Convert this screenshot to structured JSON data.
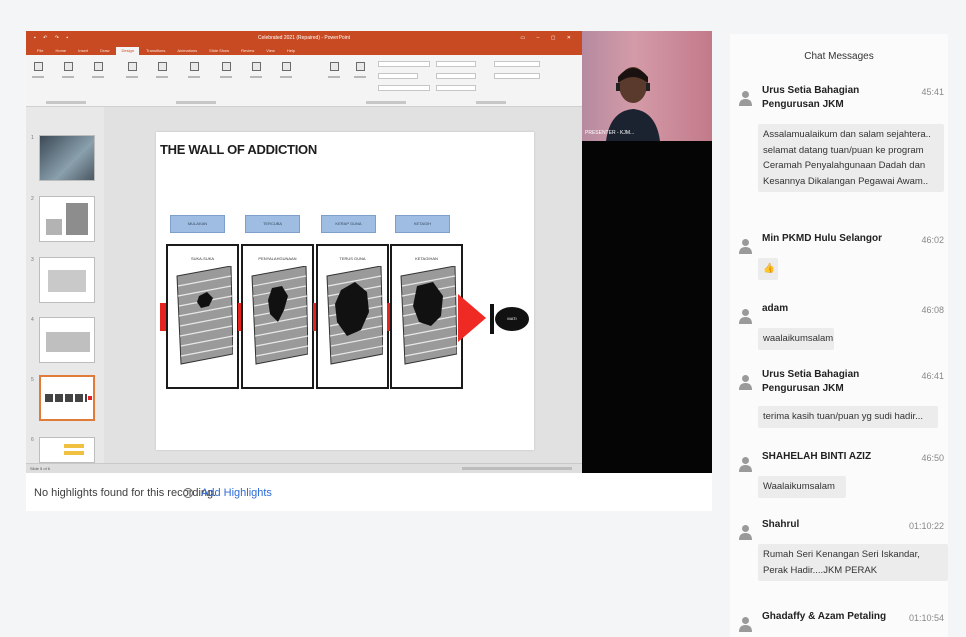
{
  "ppt": {
    "title": "Celebrated 2021 (Repaired) - PowerPoint",
    "tabs": [
      "File",
      "Home",
      "Insert",
      "Draw",
      "Design",
      "Transitions",
      "Animations",
      "Slide Show",
      "Review",
      "View",
      "Help"
    ],
    "active_tab_index": 4,
    "status_left": "Slide 5 of 6",
    "slide": {
      "title": "THE WALL OF ADDICTION",
      "stage_tags": [
        "MULAKAN",
        "TERCUBA",
        "KERAP GUNA",
        "KETAGIH"
      ],
      "panel_labels": [
        "SUKA-SUKA",
        "PENYALAHGUNAAN",
        "TERUS GUNA",
        "KETAGIHAN"
      ],
      "end_label": "MATI"
    },
    "thumb_numbers": [
      "1",
      "2",
      "3",
      "4",
      "5",
      "6"
    ],
    "selected_thumb_index": 4
  },
  "webcam": {
    "name_tag": "PRESENTER - KJM..."
  },
  "highlights": {
    "text": "No highlights found for this recording.",
    "info_icon": "info-circle-icon",
    "add_label": "Add Highlights"
  },
  "chat": {
    "title": "Chat Messages",
    "messages": [
      {
        "sender": "Urus Setia Bahagian Pengurusan JKM",
        "time": "45:41",
        "text": [
          "Assalamualaikum dan salam sejahtera..",
          "selamat datang tuan/puan ke program",
          "Ceramah Penyalahgunaan Dadah dan",
          "Kesannya Dikalangan Pegawai Awam.."
        ]
      },
      {
        "sender": "Min PKMD Hulu Selangor",
        "time": "46:02",
        "text": [
          "👍"
        ]
      },
      {
        "sender": "adam",
        "time": "46:08",
        "text": [
          "waalaikumsalam"
        ]
      },
      {
        "sender": "Urus Setia Bahagian Pengurusan JKM",
        "time": "46:41",
        "text": [
          "terima kasih tuan/puan yg sudi hadir..."
        ]
      },
      {
        "sender": "SHAHELAH BINTI AZIZ",
        "time": "46:50",
        "text": [
          "Waalaikumsalam"
        ]
      },
      {
        "sender": "Shahrul",
        "time": "01:10:22",
        "text": [
          "Rumah Seri Kenangan Seri Iskandar,",
          "Perak Hadir....JKM PERAK"
        ]
      },
      {
        "sender": "Ghadaffy & Azam Petaling",
        "time": "01:10:54",
        "text": []
      }
    ]
  },
  "colors": {
    "ppt_accent": "#c84a22",
    "stage_blue": "#9fbde2",
    "arrow_red": "#e52420",
    "link_blue": "#2d6bd6"
  }
}
